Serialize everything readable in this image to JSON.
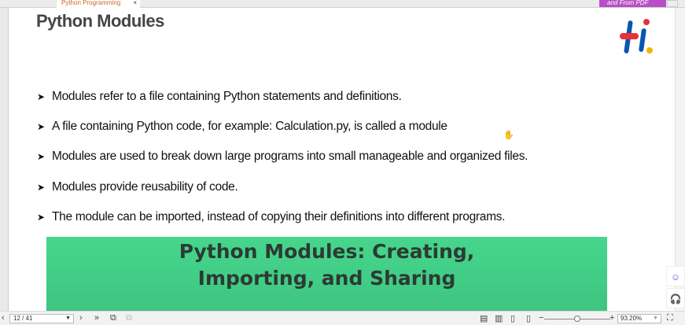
{
  "tab": {
    "label": "Python Programming",
    "close": "×"
  },
  "promo": {
    "label": "and From PDF"
  },
  "slide": {
    "title": "Python Modules",
    "bullets": [
      "Modules refer to a file containing Python statements and definitions.",
      "A file containing Python code, for example: Calculation.py, is called a module",
      "Modules are used to break down large programs into small manageable and organized files.",
      "Modules provide reusability of code.",
      "The  module can be  imported, instead of copying their definitions into different programs."
    ],
    "banner": {
      "line1": "Python Modules: Creating,",
      "line2": "Importing, and Sharing"
    },
    "logo_colors": {
      "blue": "#0a55b0",
      "red": "#e8303a",
      "yellow": "#f4b400"
    }
  },
  "status": {
    "page": "12 / 41",
    "zoom": "93.20%"
  }
}
